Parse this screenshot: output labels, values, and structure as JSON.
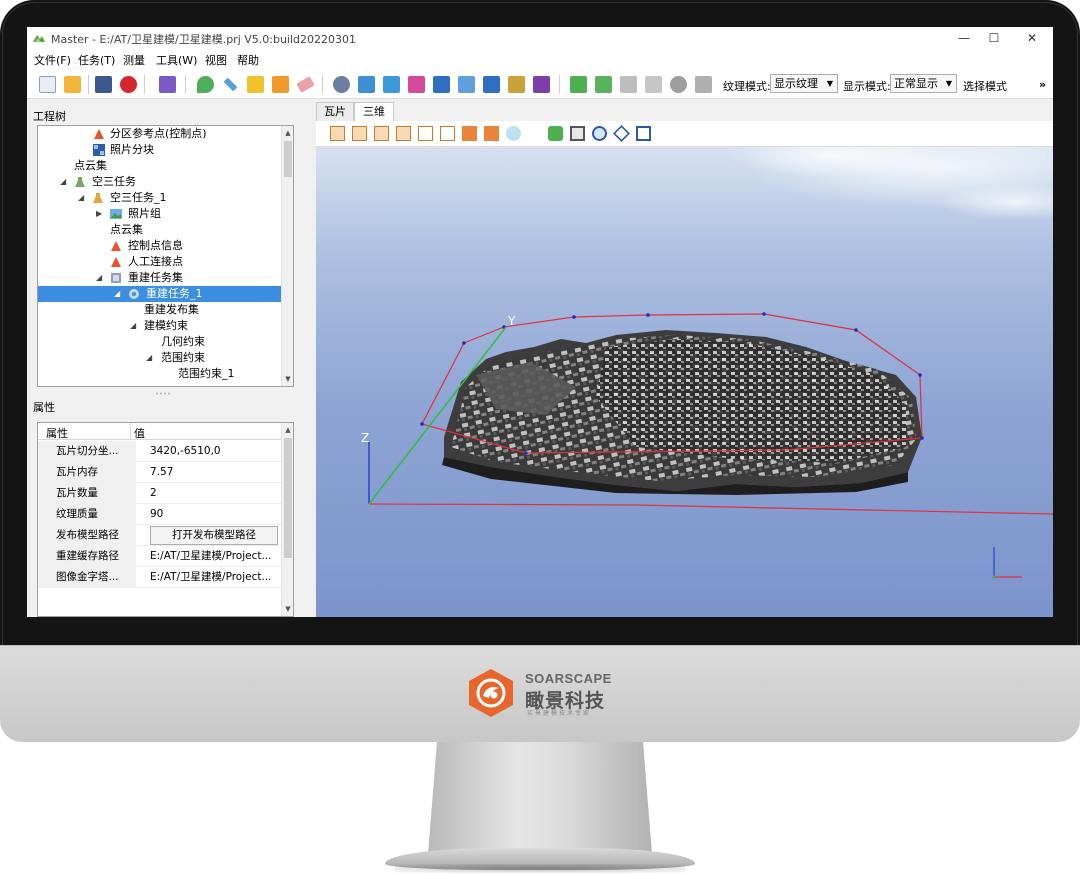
{
  "window": {
    "title": "Master - E:/AT/卫星建模/卫星建模.prj  V5.0:build20220301",
    "minimize": "—",
    "maximize": "☐",
    "close": "✕"
  },
  "menu": [
    "文件(F)",
    "任务(T)",
    "测量",
    "工具(W)",
    "视图",
    "帮助"
  ],
  "toolbar": {
    "texture_mode_label": "纹理模式:",
    "texture_mode_value": "显示纹理",
    "display_mode_label": "显示模式:",
    "display_mode_value": "正常显示",
    "select_mode_label": "选择模式",
    "overflow": "»"
  },
  "tree_panel": {
    "title": "工程树",
    "rows": [
      {
        "label": "分区参考点(控制点)",
        "icon": "warning-icon"
      },
      {
        "label": "照片分块",
        "icon": "grid-icon"
      },
      {
        "label": "点云集",
        "icon": ""
      },
      {
        "label": "空三任务",
        "icon": "flask-icon"
      },
      {
        "label": "空三任务_1",
        "icon": "flask-icon"
      },
      {
        "label": "照片组",
        "icon": "image-icon"
      },
      {
        "label": "点云集",
        "icon": ""
      },
      {
        "label": "控制点信息",
        "icon": "warning-icon"
      },
      {
        "label": "人工连接点",
        "icon": "warning-icon"
      },
      {
        "label": "重建任务集",
        "icon": "cube-icon"
      },
      {
        "label": "重建任务_1",
        "icon": "gear-icon"
      },
      {
        "label": "重建发布集",
        "icon": ""
      },
      {
        "label": "建模约束",
        "icon": ""
      },
      {
        "label": "几何约束",
        "icon": ""
      },
      {
        "label": "范围约束",
        "icon": ""
      },
      {
        "label": "范围约束_1",
        "icon": ""
      }
    ]
  },
  "props_panel": {
    "title": "属性",
    "col_key": "属性",
    "col_val": "值",
    "rows": [
      {
        "key": "瓦片切分坐...",
        "val": "3420,-6510,0"
      },
      {
        "key": "瓦片内存",
        "val": "7.57"
      },
      {
        "key": "瓦片数量",
        "val": "2"
      },
      {
        "key": "纹理质量",
        "val": "90"
      },
      {
        "key": "发布模型路径",
        "val": "打开发布模型路径"
      },
      {
        "key": "重建缓存路径",
        "val": "E:/AT/卫星建模/Project..."
      },
      {
        "key": "图像金字塔...",
        "val": "E:/AT/卫星建模/Project..."
      }
    ]
  },
  "view": {
    "tabs": [
      "瓦片",
      "三维"
    ],
    "axis_y": "Y",
    "axis_z": "Z"
  },
  "brand": {
    "name_en": "SOARSCAPE",
    "name_cn": "瞰景科技",
    "tagline": "实景建模技术专家",
    "accent": "#e8662c"
  },
  "colors": {
    "selection": "#3c8ee0",
    "boundary": "#e0313c",
    "axis_z": "#2a3fd6",
    "axis_y": "#2fbf3a"
  }
}
